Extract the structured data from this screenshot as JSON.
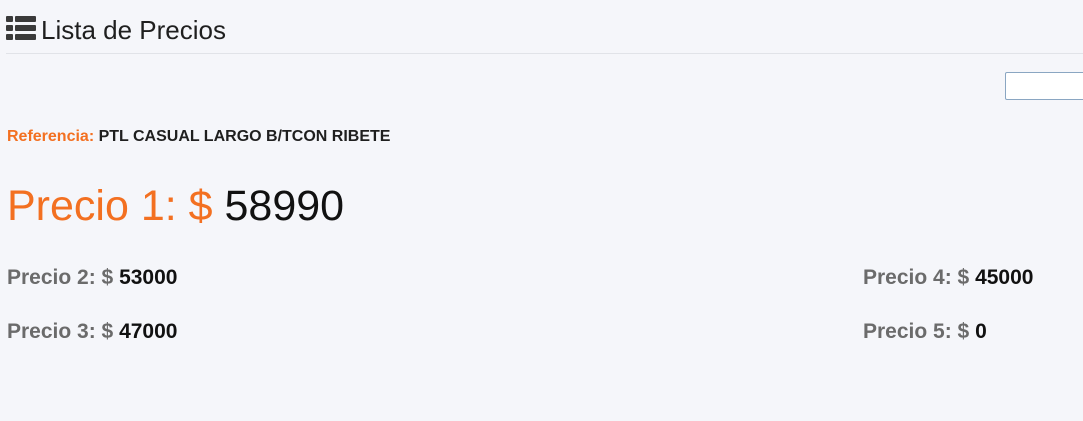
{
  "header": {
    "icon": "list-icon",
    "title": "Lista de Precios"
  },
  "search": {
    "value": "",
    "placeholder": ""
  },
  "referencia": {
    "label": "Referencia:",
    "value": "PTL CASUAL LARGO B/TCON RIBETE"
  },
  "precios": {
    "p1": {
      "label": "Precio 1: $",
      "value": "58990"
    },
    "p2": {
      "label": "Precio 2: $",
      "value": "53000"
    },
    "p3": {
      "label": "Precio 3: $",
      "value": "47000"
    },
    "p4": {
      "label": "Precio 4: $",
      "value": "45000"
    },
    "p5": {
      "label": "Precio 5: $",
      "value": "0"
    }
  },
  "colors": {
    "accent": "#f37021",
    "background": "#f5f6fa",
    "muted_label": "#6b6b6b"
  }
}
